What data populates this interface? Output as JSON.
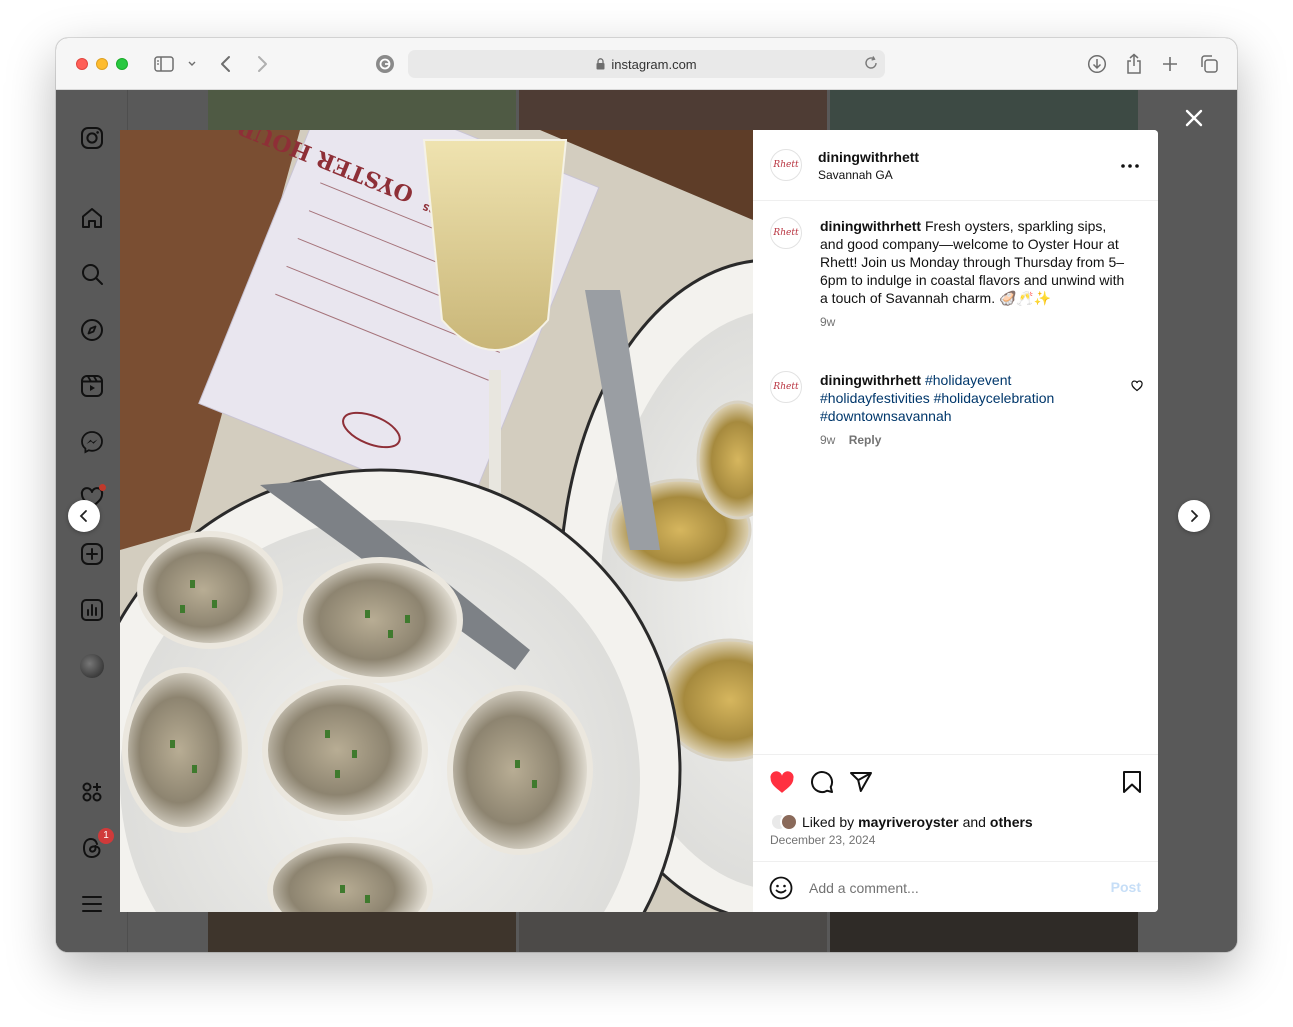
{
  "browser": {
    "url": "instagram.com"
  },
  "post": {
    "username": "diningwithrhett",
    "location": "Savannah GA",
    "avatar_text": "Rhett",
    "caption": {
      "username": "diningwithrhett",
      "text": "Fresh oysters, sparkling sips, and good company—welcome to Oyster Hour at Rhett! Join us Monday through Thursday from 5–6pm to indulge in coastal flavors and unwind with a touch of Savannah charm. 🦪🥂✨",
      "age": "9w"
    },
    "comment": {
      "username": "diningwithrhett",
      "hashtags": [
        "#holidayevent",
        "#holidayfestivities",
        "#holidaycelebration",
        "#downtownsavannah"
      ],
      "age": "9w",
      "reply_label": "Reply"
    },
    "liked_prefix": "Liked by",
    "liked_user": "mayriveroyster",
    "liked_and": "and",
    "liked_others": "others",
    "date": "December 23, 2024",
    "add_comment_placeholder": "Add a comment...",
    "post_label": "Post",
    "liked": true
  },
  "photo": {
    "menu_title": "OYSTER HOUR",
    "menu_subtitle": "OYSTERS"
  },
  "sidebar": {
    "notifications_badge": "1"
  },
  "colors": {
    "like_red": "#ff3040",
    "link_blue": "#00376b",
    "post_disabled": "#c6def7"
  }
}
